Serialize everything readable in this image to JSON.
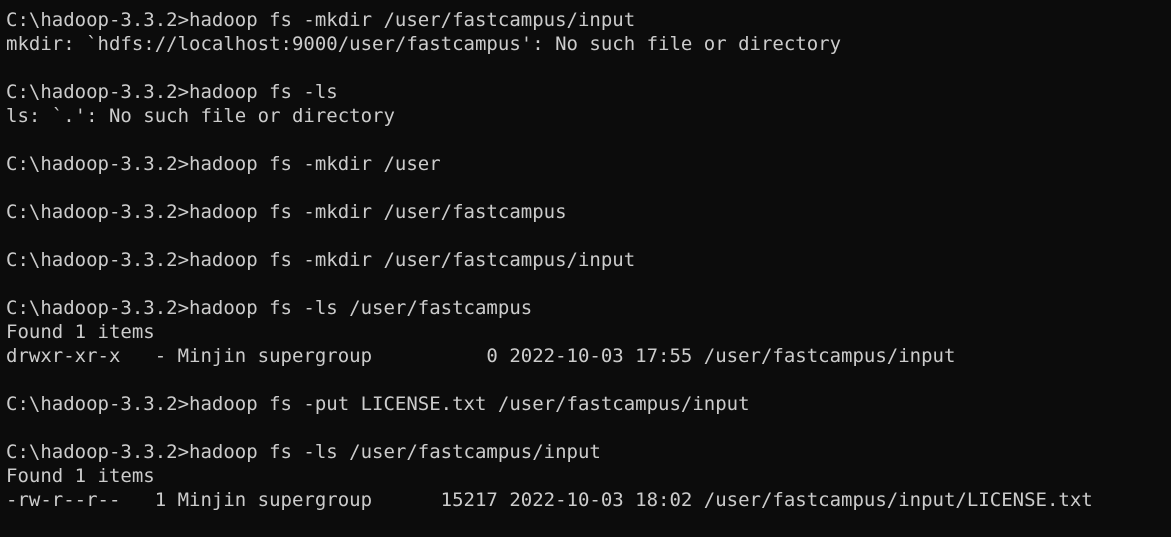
{
  "lines": [
    "C:\\hadoop-3.3.2>hadoop fs -mkdir /user/fastcampus/input",
    "mkdir: `hdfs://localhost:9000/user/fastcampus': No such file or directory",
    "",
    "C:\\hadoop-3.3.2>hadoop fs -ls",
    "ls: `.': No such file or directory",
    "",
    "C:\\hadoop-3.3.2>hadoop fs -mkdir /user",
    "",
    "C:\\hadoop-3.3.2>hadoop fs -mkdir /user/fastcampus",
    "",
    "C:\\hadoop-3.3.2>hadoop fs -mkdir /user/fastcampus/input",
    "",
    "C:\\hadoop-3.3.2>hadoop fs -ls /user/fastcampus",
    "Found 1 items",
    "drwxr-xr-x   - Minjin supergroup          0 2022-10-03 17:55 /user/fastcampus/input",
    "",
    "C:\\hadoop-3.3.2>hadoop fs -put LICENSE.txt /user/fastcampus/input",
    "",
    "C:\\hadoop-3.3.2>hadoop fs -ls /user/fastcampus/input",
    "Found 1 items",
    "-rw-r--r--   1 Minjin supergroup      15217 2022-10-03 18:02 /user/fastcampus/input/LICENSE.txt"
  ]
}
